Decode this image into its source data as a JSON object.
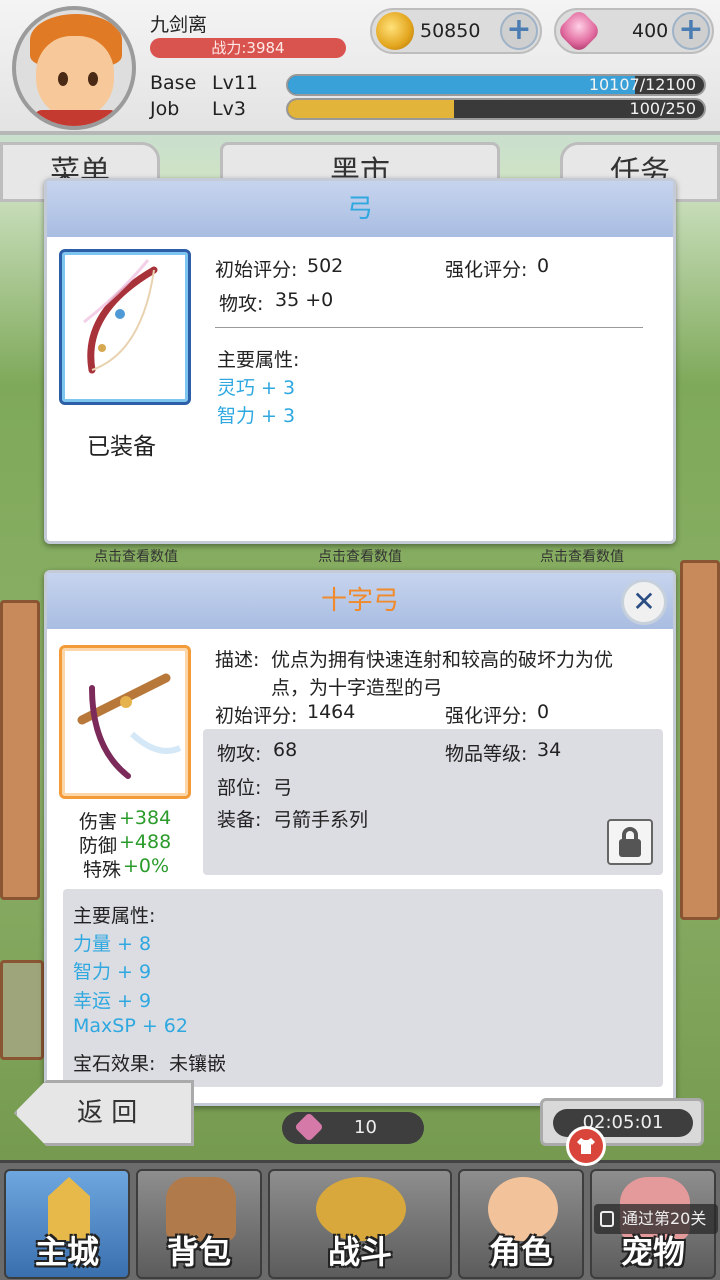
{
  "player": {
    "name": "九剑离",
    "power": "战力:3984",
    "base_label": "Base",
    "base_level": "Lv11",
    "base_exp": "10107/12100",
    "base_progress": 0.835,
    "job_label": "Job",
    "job_level": "Lv3",
    "job_exp": "100/250",
    "job_progress": 0.4
  },
  "currency": {
    "coins": "50850",
    "gems": "400",
    "plus": "+"
  },
  "background_tabs": {
    "left": "菜单",
    "center": "黑市",
    "right": "任务",
    "hint": "点击查看数值"
  },
  "equipped_dialog": {
    "title": "弓",
    "status": "已装备",
    "initial_score_label": "初始评分:",
    "initial_score": "502",
    "enhance_score_label": "强化评分:",
    "enhance_score": "0",
    "atk_label": "物攻:",
    "atk_value": "35 +0",
    "main_attr_label": "主要属性:",
    "attrs": [
      "灵巧 + 3",
      "智力 + 3"
    ]
  },
  "item_dialog": {
    "title": "十字弓",
    "close": "✕",
    "desc_label": "描述:",
    "desc_line1": "优点为拥有快速连射和较高的破坏力为优",
    "desc_line2": "点，为十字造型的弓",
    "initial_score_label": "初始评分:",
    "initial_score": "1464",
    "enhance_score_label": "强化评分:",
    "enhance_score": "0",
    "atk_label": "物攻:",
    "atk_value": "68",
    "item_level_label": "物品等级:",
    "item_level": "34",
    "slot_label": "部位:",
    "slot_value": "弓",
    "equip_label": "装备:",
    "equip_value": "弓箭手系列",
    "compare": [
      {
        "label": "伤害",
        "value": "+384"
      },
      {
        "label": "防御",
        "value": "+488"
      },
      {
        "label": "特殊",
        "value": "+0%"
      }
    ],
    "main_attr_label": "主要属性:",
    "attrs": [
      "力量 + 8",
      "智力 + 9",
      "幸运 + 9",
      "MaxSP + 62"
    ],
    "gem_effect_label": "宝石效果:",
    "gem_effect_value": "未镶嵌"
  },
  "bottom": {
    "back": "返 回",
    "gem_count": "10",
    "timer": "02:05:01",
    "lock_hint": "通过第20关",
    "nav": [
      "主城",
      "背包",
      "战斗",
      "角色",
      "宠物"
    ]
  },
  "colors": {
    "header_blue": "#a9bde2",
    "equipped_title": "#2fa8e0",
    "item_title": "#f08a2a",
    "attr_blue": "#2fa8e0",
    "compare_green": "#2b9b2b",
    "power_red": "#d9534f",
    "base_bar": "#3aa0d8",
    "job_bar": "#e2b53a"
  }
}
